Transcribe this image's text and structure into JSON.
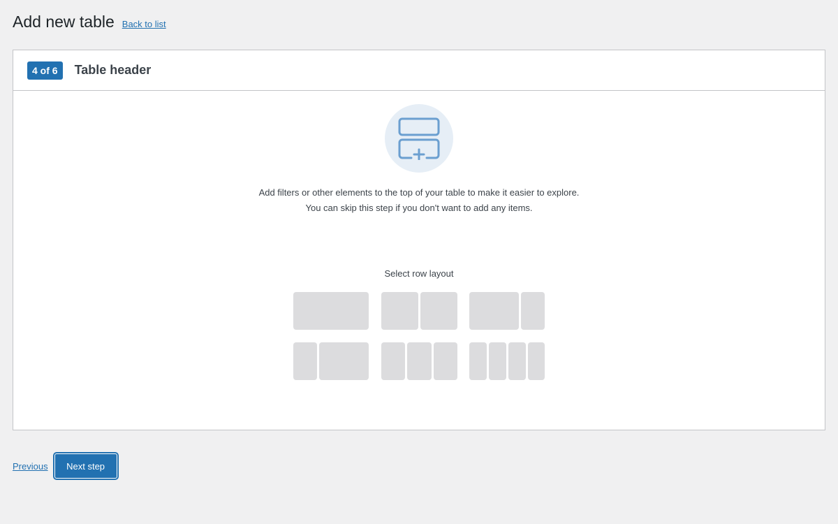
{
  "header": {
    "title": "Add new table",
    "back_link": "Back to list"
  },
  "step": {
    "badge": "4 of 6",
    "title": "Table header"
  },
  "intro": {
    "icon": "table-header-add-icon",
    "line1": "Add filters or other elements to the top of your table to make it easier to explore.",
    "line2": "You can skip this step if you don't want to add any items."
  },
  "layout_picker": {
    "label": "Select row layout",
    "options": [
      {
        "name": "one-column"
      },
      {
        "name": "two-equal-columns"
      },
      {
        "name": "wide-left-narrow-right"
      },
      {
        "name": "narrow-left-wide-right"
      },
      {
        "name": "three-columns"
      },
      {
        "name": "four-columns"
      }
    ]
  },
  "footer": {
    "previous_label": "Previous",
    "next_label": "Next step"
  },
  "colors": {
    "accent": "#2271b1",
    "background": "#f0f0f1",
    "layout_cell": "#dcdcde",
    "icon_circle": "#e6eef6"
  }
}
